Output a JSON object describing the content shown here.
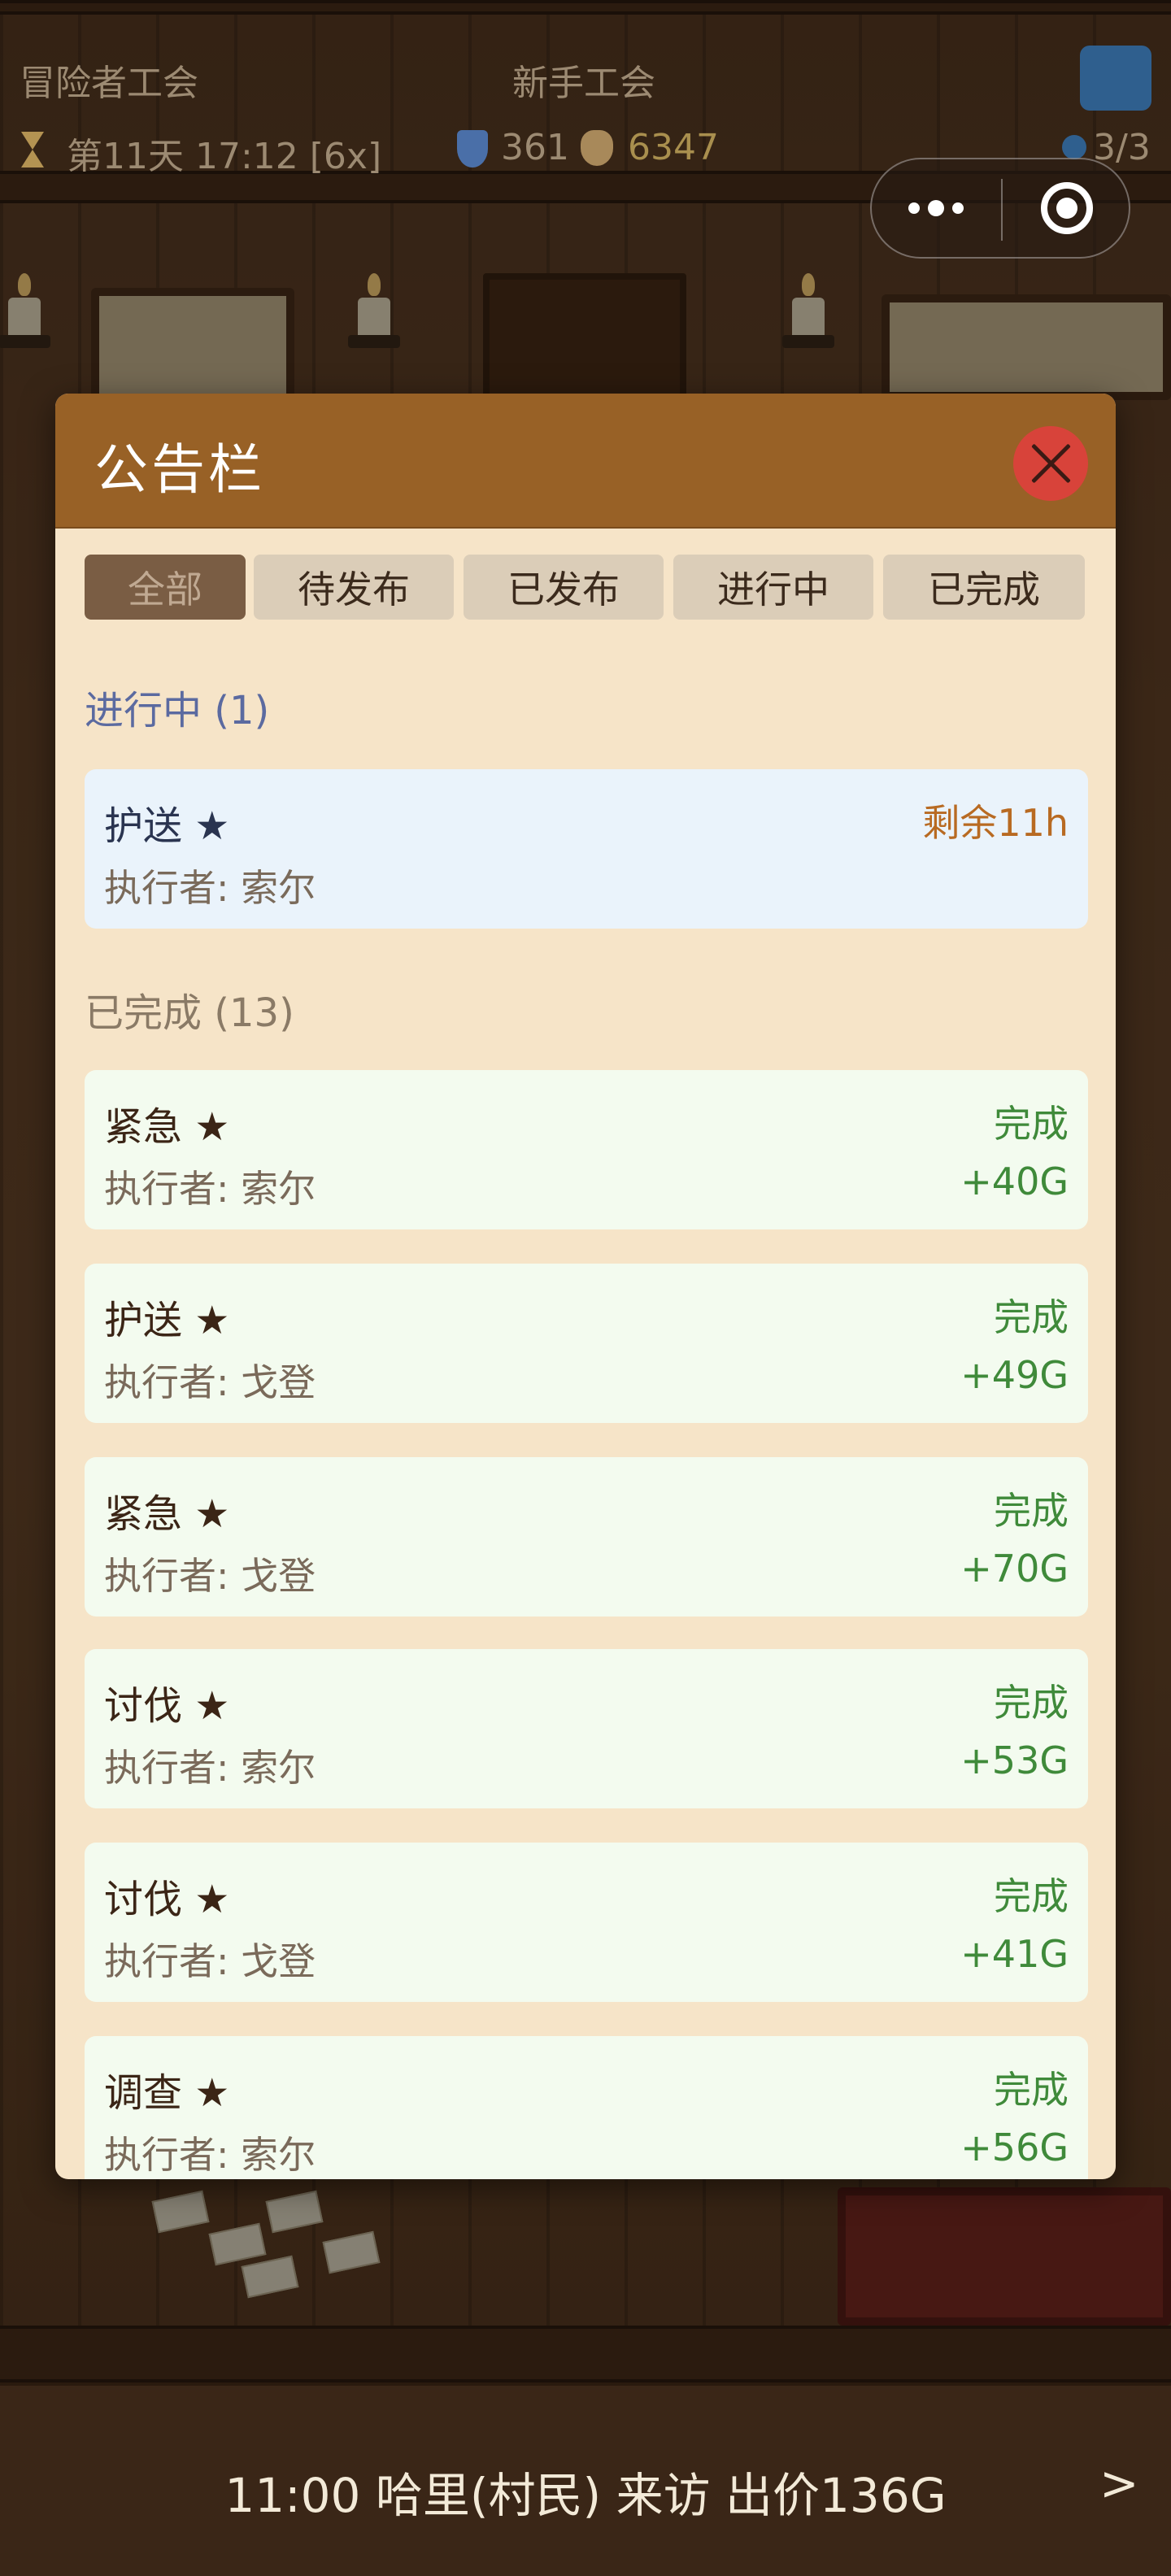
{
  "hud": {
    "guild_title": "冒险者工会",
    "guild_rank": "新手工会",
    "day_time": "第11天 17:12 [6x]",
    "reputation": "361",
    "gold": "6347",
    "staff": "3/3"
  },
  "bulletin": {
    "title": "公告栏",
    "tabs": [
      {
        "label": "全部",
        "active": true
      },
      {
        "label": "待发布"
      },
      {
        "label": "已发布"
      },
      {
        "label": "进行中"
      },
      {
        "label": "已完成"
      }
    ],
    "in_progress_heading": "进行中 (1)",
    "in_progress": [
      {
        "title": "护送 ★",
        "executor": "执行者: 索尔",
        "status": "剩余11h"
      }
    ],
    "completed_heading": "已完成 (13)",
    "completed": [
      {
        "title": "紧急 ★",
        "executor": "执行者: 索尔",
        "status": "完成",
        "reward": "+40G"
      },
      {
        "title": "护送 ★",
        "executor": "执行者: 戈登",
        "status": "完成",
        "reward": "+49G"
      },
      {
        "title": "紧急 ★",
        "executor": "执行者: 戈登",
        "status": "完成",
        "reward": "+70G"
      },
      {
        "title": "讨伐 ★",
        "executor": "执行者: 索尔",
        "status": "完成",
        "reward": "+53G"
      },
      {
        "title": "讨伐 ★",
        "executor": "执行者: 戈登",
        "status": "完成",
        "reward": "+41G"
      },
      {
        "title": "调查 ★",
        "executor": "执行者: 索尔",
        "status": "完成",
        "reward": "+56G"
      }
    ]
  },
  "event_bar": {
    "text": "11:00 哈里(村民) 来访 出价136G",
    "next_label": ">"
  },
  "icons": {
    "hourglass": "hourglass-icon",
    "shield": "shield-icon",
    "gold": "money-bag-icon",
    "staff": "person-icon",
    "more": "more-dots-icon",
    "target": "target-icon",
    "close": "close-icon"
  }
}
